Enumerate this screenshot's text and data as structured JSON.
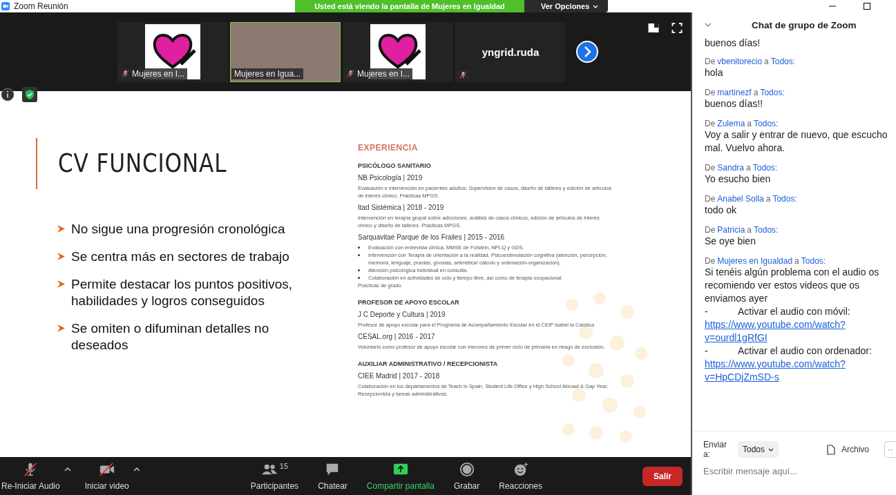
{
  "window": {
    "title": "Zoom Reunión"
  },
  "share_banner": {
    "text": "Usted está viendo la pantalla de Mujeres en Igualdad",
    "options": "Ver Opciones"
  },
  "thumbnails": [
    {
      "kind": "avatar",
      "name": "Mujeres en I...",
      "muted": true,
      "speaking": false
    },
    {
      "kind": "video",
      "name": "Mujeres en Igua...",
      "muted": false,
      "speaking": true
    },
    {
      "kind": "avatar",
      "name": "Mujeres en I...",
      "muted": true,
      "speaking": false
    },
    {
      "kind": "text",
      "display": "yngrid.ruda",
      "muted": true,
      "speaking": false
    }
  ],
  "slide": {
    "title": "CV FUNCIONAL",
    "bullets": [
      "No sigue una progresión cronológica",
      "Se centra más en sectores de trabajo",
      "Permite destacar los puntos positivos, habilidades y logros conseguidos",
      "Se omiten o difuminan detalles no deseados"
    ],
    "cv": {
      "heading": "EXPERIENCIA",
      "sections": [
        {
          "title": "PSICÓLOGO SANITARIO",
          "entries": [
            {
              "org": "NB Psicología | 2019",
              "text": "Evaluación e intervención en pacientes adultos; Supervisión de casos, diseño de talleres y edición de artículos de interés clínico. Prácticas MPGS."
            },
            {
              "org": "Itad Sistémica | 2018 - 2019",
              "text": "Intervención en terapia grupal sobre adicciones, análisis de casos clínicos, edición de artículos de interés clínico y diseño de talleres. Prácticas MPGS."
            },
            {
              "org": "Sarquavitae Parque de los Frailes | 2015 - 2016",
              "items": [
                "Evaluación con entrevista clínica, MMSE de Folstein, NPI-Q y GDS.",
                "Intervención con Terapia de orientación a la realidad, Psicoestimulación cognitiva (atención, percepción, memoria, lenguaje, praxias, gnosias, aritmética/ cálculo y ordenación-organización).",
                "Atención psicológica individual en consulta.",
                "Colaboración en actividades de ocio y tiempo libre, así como de terapia ocupacional."
              ],
              "text": "Prácticas de grado."
            }
          ]
        },
        {
          "title": "PROFESOR DE APOYO ESCOLAR",
          "entries": [
            {
              "org": "J C Deporte y Cultura | 2019",
              "text": "Profesor de apoyo escolar para el Programa de Acompañamiento Escolar en el CEIP Isabel la Católica"
            },
            {
              "org": "CESAL.org | 2016 - 2017",
              "text": "Voluntario como profesor de apoyo escolar con menores de primer ciclo de primaria en riesgo de exclusión."
            }
          ]
        },
        {
          "title": "AUXILIAR ADMINISTRATIVO / RECEPCIONISTA",
          "entries": [
            {
              "org": "CIEE Madrid | 2017 - 2018",
              "text": "Colaboración en los departamentos de Teach in Spain, Student Life Office y High School Abroad & Gap Year; Recepcionista y tareas administrativas."
            }
          ]
        }
      ]
    }
  },
  "toolbar": {
    "items": [
      {
        "kind": "audio",
        "label": "Re-Iniciar Audio",
        "muted": true
      },
      {
        "kind": "video",
        "label": "Iniciar video",
        "muted": true
      },
      {
        "kind": "participants",
        "label": "Participantes",
        "count": "15"
      },
      {
        "kind": "chat",
        "label": "Chatear"
      },
      {
        "kind": "share",
        "label": "Compartir pantalla"
      },
      {
        "kind": "record",
        "label": "Grabar"
      },
      {
        "kind": "reactions",
        "label": "Reacciones"
      }
    ],
    "leave": "Salir"
  },
  "chat": {
    "title": "Chat de grupo de Zoom",
    "partial_message": "buenos días!",
    "messages": [
      {
        "prefix": "De",
        "sender": "vbenitorecio",
        "joiner": "a",
        "recipient": "Todos:",
        "parts": [
          {
            "kind": "text",
            "text": "hola"
          }
        ]
      },
      {
        "prefix": "De",
        "sender": "martinezf",
        "joiner": "a",
        "recipient": "Todos:",
        "parts": [
          {
            "kind": "text",
            "text": "buenos días!!"
          }
        ]
      },
      {
        "prefix": "De",
        "sender": "Zulema",
        "joiner": "a",
        "recipient": "Todos:",
        "parts": [
          {
            "kind": "text",
            "text": "Voy a salir y entrar de nuevo, que escucho mal. Vuelvo ahora."
          }
        ]
      },
      {
        "prefix": "De",
        "sender": "Sandra",
        "joiner": "a",
        "recipient": "Todos:",
        "parts": [
          {
            "kind": "text",
            "text": "Yo esucho bien"
          }
        ]
      },
      {
        "prefix": "De",
        "sender": "Anabel Solla",
        "joiner": "a",
        "recipient": "Todos:",
        "parts": [
          {
            "kind": "text",
            "text": "todo ok"
          }
        ]
      },
      {
        "prefix": "De",
        "sender": "Patricia",
        "joiner": "a",
        "recipient": "Todos:",
        "parts": [
          {
            "kind": "text",
            "text": "Se oye bien"
          }
        ]
      },
      {
        "prefix": "De",
        "sender": "Mujeres en Igualdad",
        "joiner": "a",
        "recipient": "Todos:",
        "parts": [
          {
            "kind": "text",
            "text": "Si tenéis algún problema con el audio os recomiendo ver estos videos que os enviamos ayer"
          },
          {
            "kind": "text",
            "text": "-\tActivar el audio con móvil:"
          },
          {
            "kind": "link",
            "text": "https://www.youtube.com/watch?v=ourdl1gRfGI"
          },
          {
            "kind": "text",
            "text": "-\tActivar el audio con ordenador:"
          },
          {
            "kind": "link",
            "text": "https://www.youtube.com/watch?v=HpCDjZmSD-s"
          }
        ]
      }
    ],
    "send_label": "Enviar a:",
    "recipient_button": "Todos",
    "file_button": "Archivo",
    "more_button": "··",
    "input": {
      "placeholder": "Escribir mensaje aquí..."
    }
  }
}
